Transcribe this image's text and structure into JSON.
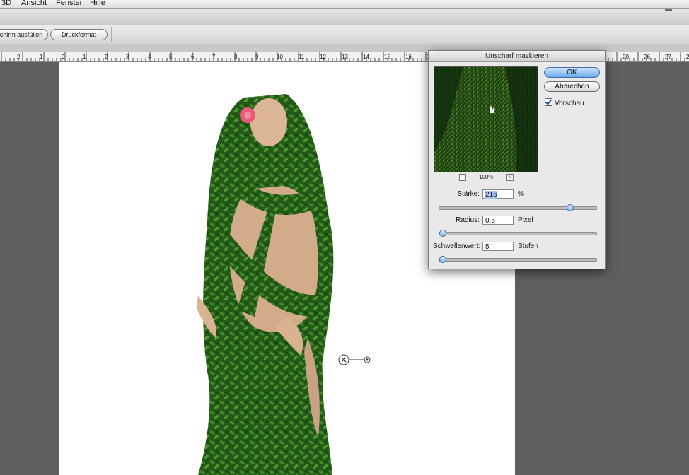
{
  "menu": {
    "items": [
      "3D",
      "Ansicht",
      "Fenster",
      "Hilfe"
    ]
  },
  "toolbar": {
    "fill_screen_label": "chirm ausfüllen",
    "print_format_label": "Druckformat"
  },
  "ruler": {
    "labels": [
      "2",
      "1",
      "0",
      "1",
      "2",
      "3",
      "4",
      "5",
      "6",
      "7",
      "8",
      "9",
      "10",
      "11",
      "12",
      "13",
      "14",
      "15",
      "16",
      "17",
      "18",
      "19",
      "20",
      "26",
      "27",
      "28"
    ]
  },
  "dialog": {
    "title": "Unscharf maskieren",
    "ok_label": "OK",
    "cancel_label": "Abbrechen",
    "preview_checkbox_label": "Vorschau",
    "preview_checked": true,
    "zoom_level": "100%",
    "zoom_out_label": "−",
    "zoom_in_label": "+",
    "fields": [
      {
        "label": "Stärke:",
        "value": "216",
        "unit": "%",
        "slider_fraction": 0.83
      },
      {
        "label": "Radius:",
        "value": "0,5",
        "unit": "Pixel",
        "slider_fraction": 0.02
      },
      {
        "label": "Schwellenwert:",
        "value": "5",
        "unit": "Stufen",
        "slider_fraction": 0.02
      }
    ]
  },
  "colors": {
    "canvas_bg": "#5f5f5f",
    "foliage": "#2f6b1f",
    "skin": "#d6b08e",
    "flower": "#e85a78",
    "accent_button": "#6aa8ec"
  }
}
